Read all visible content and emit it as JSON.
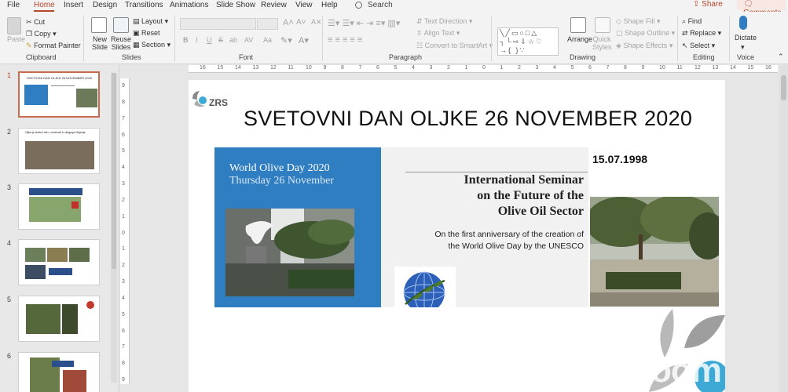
{
  "menu": {
    "tabs": [
      "File",
      "Home",
      "Insert",
      "Design",
      "Transitions",
      "Animations",
      "Slide Show",
      "Review",
      "View",
      "Help"
    ],
    "active": "Home",
    "search": "Search",
    "share": "Share",
    "comments": "Comments"
  },
  "ribbon": {
    "clipboard": {
      "label": "Clipboard",
      "paste": "Paste",
      "cut": "Cut",
      "copy": "Copy",
      "format_painter": "Format Painter"
    },
    "slides": {
      "label": "Slides",
      "new_slide": "New Slide",
      "reuse_slides": "Reuse Slides",
      "layout": "Layout",
      "reset": "Reset",
      "section": "Section"
    },
    "font": {
      "label": "Font",
      "bold": "B",
      "italic": "I",
      "underline": "U",
      "strike": "S",
      "shadow": "ab",
      "spacing": "AV",
      "case": "Aa"
    },
    "paragraph": {
      "label": "Paragraph",
      "text_direction": "Text Direction",
      "align_text": "Align Text",
      "smartart": "Convert to SmartArt"
    },
    "drawing": {
      "label": "Drawing",
      "arrange": "Arrange",
      "quick_styles": "Quick Styles",
      "shape_fill": "Shape Fill",
      "shape_outline": "Shape Outline",
      "shape_effects": "Shape Effects"
    },
    "editing": {
      "label": "Editing",
      "find": "Find",
      "replace": "Replace",
      "select": "Select"
    },
    "voice": {
      "label": "Voice",
      "dictate": "Dictate"
    }
  },
  "thumbnails": [
    {
      "num": "1",
      "selected": true,
      "caption": "SVETOVNI DAN OLJKE 26 NOVEMBER 2020"
    },
    {
      "num": "2",
      "selected": false,
      "caption": "Oljka je simbol miru, modrosti in dolgega življenja"
    },
    {
      "num": "3",
      "selected": false,
      "caption": ""
    },
    {
      "num": "4",
      "selected": false,
      "caption": ""
    },
    {
      "num": "5",
      "selected": false,
      "caption": ""
    },
    {
      "num": "6",
      "selected": false,
      "caption": ""
    }
  ],
  "ruler": {
    "h": [
      "16",
      "15",
      "14",
      "13",
      "12",
      "11",
      "10",
      "9",
      "8",
      "7",
      "6",
      "5",
      "4",
      "3",
      "2",
      "1",
      "0",
      "1",
      "2",
      "3",
      "4",
      "5",
      "6",
      "7",
      "8",
      "9",
      "10",
      "11",
      "12",
      "13",
      "14",
      "15",
      "16"
    ],
    "v": [
      "9",
      "8",
      "7",
      "6",
      "5",
      "4",
      "3",
      "2",
      "1",
      "0",
      "1",
      "2",
      "3",
      "4",
      "5",
      "6",
      "7",
      "8",
      "9"
    ]
  },
  "slide": {
    "logo_text": "ZRS",
    "title": "SVETOVNI DAN OLJKE 26 NOVEMBER 2020",
    "wod_title": "World Olive Day 2020",
    "wod_sub": "Thursday 26 November",
    "seminar": [
      "International Seminar",
      "on the Future of the",
      "Olive Oil Sector"
    ],
    "anniversary": [
      "On the first anniversary of the creation of",
      "the World Olive Day by the UNESCO"
    ],
    "date": "15.07.1998"
  },
  "watermark": "zoom",
  "colors": {
    "accent": "#b7472a",
    "slide_blue": "#2f7ec1",
    "logo_blue": "#3fa9d6"
  }
}
